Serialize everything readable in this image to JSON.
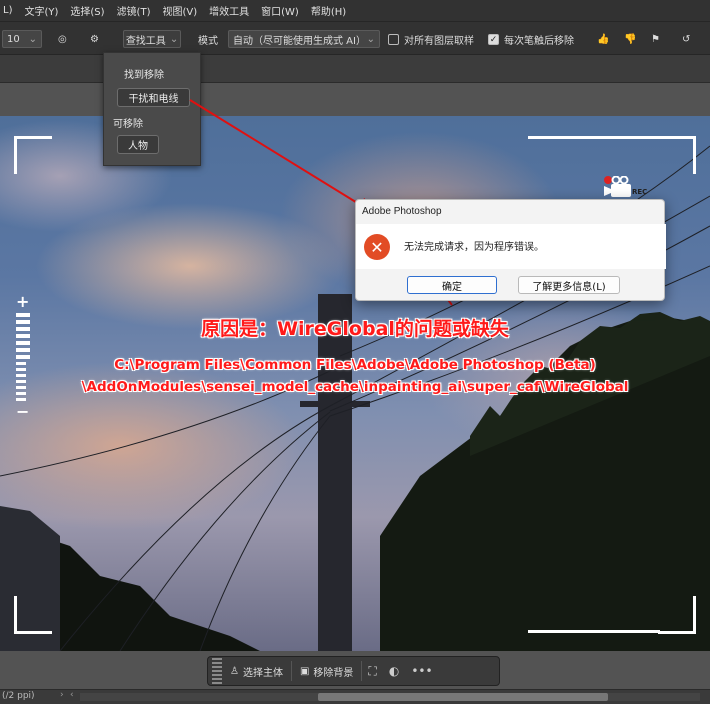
{
  "menu": [
    "L)",
    "文字(Y)",
    "选择(S)",
    "滤镜(T)",
    "视图(V)",
    "增效工具",
    "窗口(W)",
    "帮助(H)"
  ],
  "options": {
    "brush_size": "10",
    "tool_dropdown": "查找工具",
    "mode_label": "模式",
    "mode_value": "自动（尽可能使用生成式 AI）",
    "sample_all_layers": "对所有图层取样",
    "sample_all_layers_checked": false,
    "each_stroke": "每次笔触后移除",
    "each_stroke_checked": true
  },
  "dropdown": {
    "section1": "找到移除",
    "button1": "干扰和电线",
    "section2": "可移除",
    "button2": "人物"
  },
  "dialog": {
    "title": "Adobe Photoshop",
    "message": "无法完成请求，因为程序错误。",
    "ok": "确定",
    "more": "了解更多信息(L)"
  },
  "overlay_text": {
    "cause": "原因是：WireGlobal的问题或缺失",
    "path_line1": "C:\\Program Files\\Common Files\\Adobe\\Adobe Photoshop (Beta)",
    "path_line2": "\\AddOnModules\\sensei_model_cache\\inpainting_ai\\super_caf\\WireGlobal"
  },
  "camera": {
    "rec_label": "REC"
  },
  "context_bar": {
    "select_subject": "选择主体",
    "remove_bg": "移除背景"
  },
  "status": {
    "zoom": "(/2 ppi)"
  },
  "colors": {
    "annotation": "#ff1a1a",
    "error_icon": "#e24c25"
  }
}
